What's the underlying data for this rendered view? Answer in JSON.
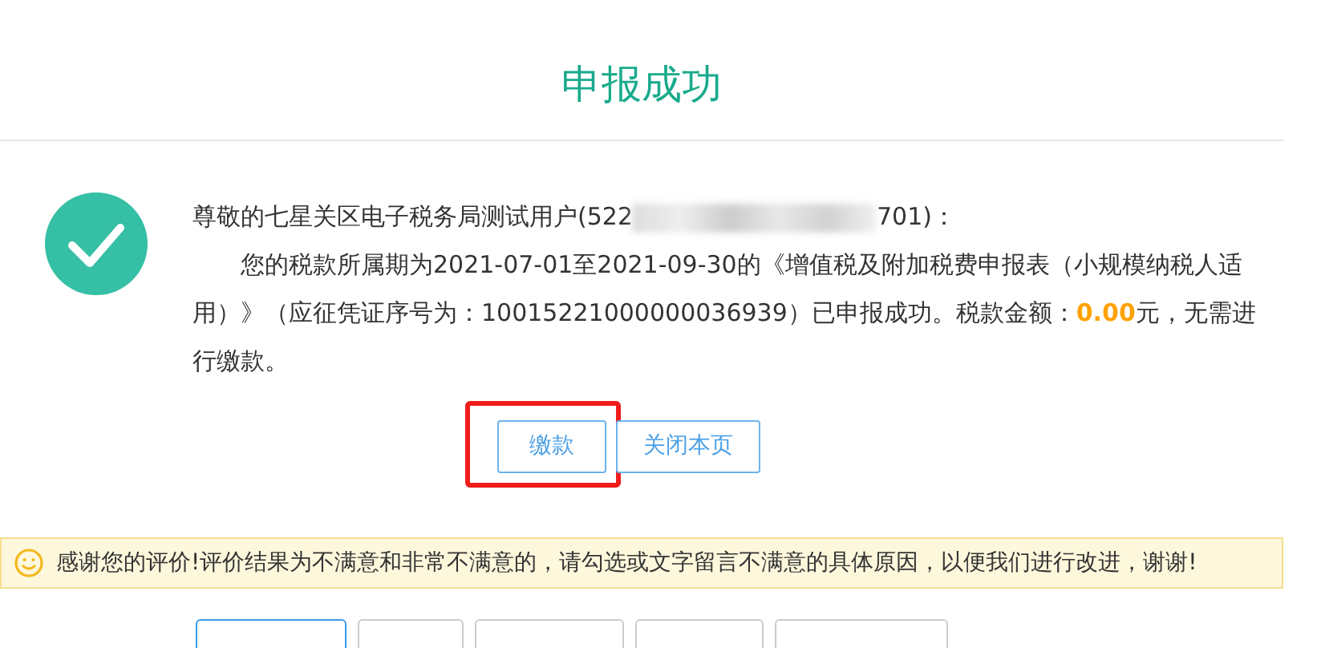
{
  "title": "申报成功",
  "status": {
    "kind": "success"
  },
  "greeting": {
    "before": "尊敬的七星关区电子税务局测试用户(522",
    "after": "701)："
  },
  "message": {
    "text": "您的税款所属期为2021-07-01至2021-09-30的《增值税及附加税费申报表（小规模纳税人适用）》（应征凭证序号为：10015221000000036939）已申报成功。税款金额：",
    "amount": "0.00",
    "tail": "元，无需进行缴款。"
  },
  "buttons": [
    {
      "label": "缴款",
      "highlighted": true
    },
    {
      "label": "关闭本页",
      "highlighted": false
    }
  ],
  "notice": {
    "text": "感谢您的评价!评价结果为不满意和非常不满意的，请勾选或文字留言不满意的具体原因，以便我们进行改进，谢谢!"
  },
  "rating_options": [
    {
      "selected": true
    },
    {
      "selected": false
    },
    {
      "selected": false
    },
    {
      "selected": false
    },
    {
      "selected": false
    }
  ]
}
